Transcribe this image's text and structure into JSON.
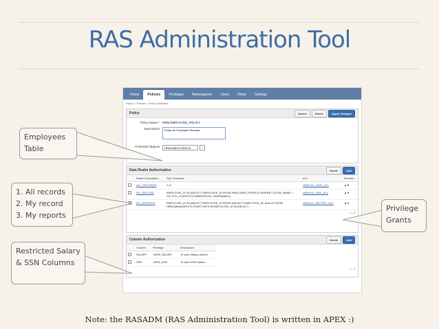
{
  "slide": {
    "title": "RAS Administration Tool",
    "note": "Note: the RASADM (RAS Administration Tool) is written in APEX :)"
  },
  "app": {
    "tabs": [
      "Home",
      "Policies",
      "Privileges",
      "Namespaces",
      "Users",
      "Roles",
      "Settings"
    ],
    "active_tab": "Policies",
    "breadcrumb": "Home > Policies > Policy Definition"
  },
  "policy": {
    "header": "Policy",
    "cancel": "Cancel",
    "delete": "Delete",
    "apply": "Apply Changes",
    "name_label": "Policy Name",
    "name_required": "*",
    "name_value": "HRM.EMPLOYEE_POLICY",
    "desc_label": "Description",
    "desc_value": "Policy for Employee Records",
    "obj_label": "Protected Objects",
    "obj_value": "HRM.EMPLOYEES",
    "obj_button": "+"
  },
  "realm": {
    "header": "Data Realm Authorization",
    "delete": "Delete",
    "add": "Add",
    "columns": [
      "",
      "Realm Description",
      "SQL Predicate",
      "ACL",
      "Reorder"
    ],
    "rows": [
      {
        "desc": "ALL_RECORDS",
        "pred": "1=1",
        "acl": "HRM.ALL_EMP_ACL",
        "reorder": "▲▼"
      },
      {
        "desc": "MY_RECORD",
        "pred": "EMPLOYEE_ID IN (SELECT EMPLOYEE_ID FROM HRM.USER_PROFILE WHERE LOGON_NAME = XS_SYS_CONTEXT('XS$SESSION','USERNAME'))",
        "acl": "HRM.MY_EMP_ACL",
        "reorder": "▲▼"
      },
      {
        "desc": "MY_REPORTS",
        "pred": "EMPLOYEE_ID IN (SELECT EMPLOYEE_ID FROM (SELECT EMPLOYEE_ID, level lvl FROM HRM.MANAGERS M START WITH M.EMPLOYEE_ID IN (SELECT ...",
        "acl": "HRM.MY_REPORT_ACL",
        "reorder": "▲▼"
      }
    ],
    "pager": "1 - 3"
  },
  "column_auth": {
    "header": "Column Authorization",
    "delete": "Delete",
    "add": "Add",
    "columns": [
      "",
      "Column",
      "Privilege",
      "Description"
    ],
    "rows": [
      {
        "col": "SALARY",
        "priv": "VIEW_SALARY",
        "desc": "To view Salary column"
      },
      {
        "col": "SSN",
        "priv": "VIEW_SSN",
        "desc": "To view SSN column"
      }
    ],
    "pager": "1 - 2"
  },
  "callouts": {
    "employees": "Employees Table",
    "records_1": "1. All records",
    "records_2": "2. My record",
    "records_3": "3. My reports",
    "privilege": "Privilege Grants",
    "restricted": "Restricted Salary & SSN Columns"
  }
}
